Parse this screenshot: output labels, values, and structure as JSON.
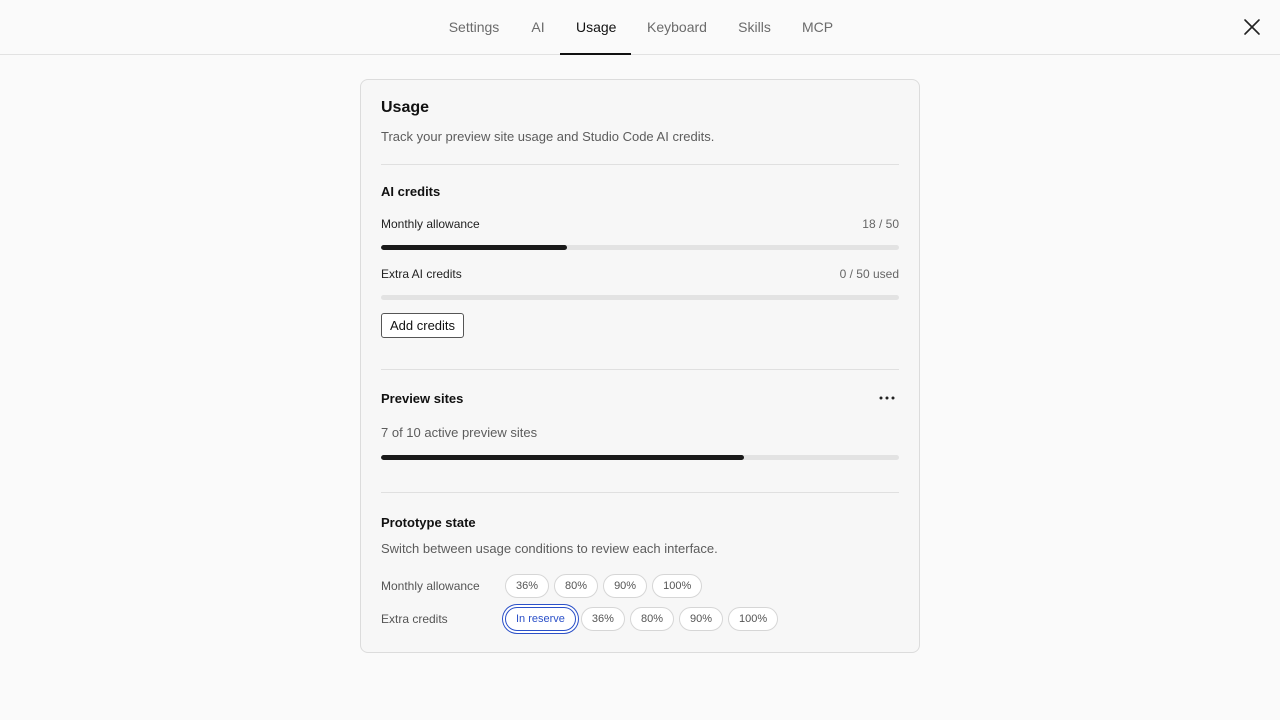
{
  "tabs": [
    {
      "label": "Settings"
    },
    {
      "label": "AI"
    },
    {
      "label": "Usage",
      "active": true
    },
    {
      "label": "Keyboard"
    },
    {
      "label": "Skills"
    },
    {
      "label": "MCP"
    }
  ],
  "usage": {
    "title": "Usage",
    "subtitle": "Track your preview site usage and Studio Code AI credits."
  },
  "ai_credits": {
    "heading": "AI credits",
    "monthly_label": "Monthly allowance",
    "monthly_value": "18 / 50",
    "monthly_fraction": 0.36,
    "extra_label": "Extra AI credits",
    "extra_value": "0 / 50 used",
    "extra_fraction": 0,
    "add_button": "Add credits"
  },
  "preview_sites": {
    "heading": "Preview sites",
    "status": "7 of 10 active preview sites",
    "fraction": 0.7
  },
  "prototype": {
    "heading": "Prototype state",
    "subtitle": "Switch between usage conditions to review each interface.",
    "monthly_label": "Monthly allowance",
    "monthly_options": [
      "36%",
      "80%",
      "90%",
      "100%"
    ],
    "extra_label": "Extra credits",
    "extra_options": [
      "In reserve",
      "36%",
      "80%",
      "90%",
      "100%"
    ],
    "extra_selected": "In reserve"
  },
  "colors": {
    "accent": "#2b50c8",
    "bar_fill": "#1a1a1a",
    "bar_track": "#e3e3e3"
  },
  "icons": {
    "close": "close-icon",
    "more": "more-horizontal-icon"
  }
}
